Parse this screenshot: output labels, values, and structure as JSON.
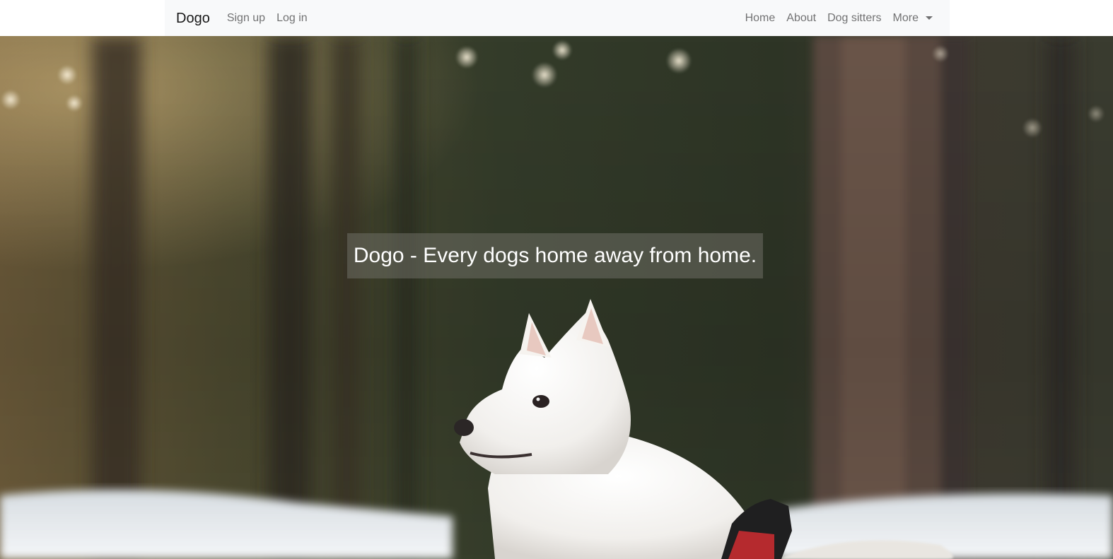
{
  "navbar": {
    "brand": "Dogo",
    "left_links": [
      "Sign up",
      "Log in"
    ],
    "right_links": [
      "Home",
      "About",
      "Dog sitters"
    ],
    "dropdown_label": "More"
  },
  "hero": {
    "tagline": "Dogo - Every dogs home away from home.",
    "image_subject": "white spitz dog in snowy forest"
  },
  "colors": {
    "navbar_bg": "#f8f9fa",
    "nav_link": "#6c757d",
    "brand": "#1a1a1a"
  }
}
